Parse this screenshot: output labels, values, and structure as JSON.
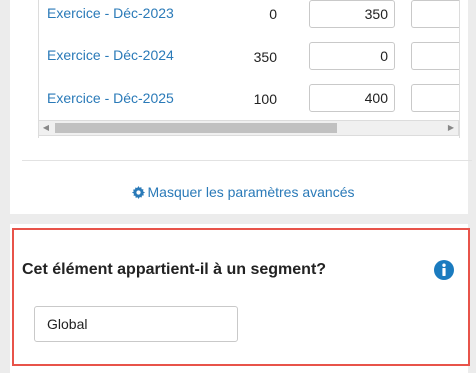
{
  "table": {
    "rows": [
      {
        "label": "Exercice - Déc-2023",
        "value": "0",
        "input": "350"
      },
      {
        "label": "Exercice - Déc-2024",
        "value": "350",
        "input": "0"
      },
      {
        "label": "Exercice - Déc-2025",
        "value": "100",
        "input": "400"
      }
    ],
    "scroll_left_icon": "arrow-left-icon",
    "scroll_right_icon": "arrow-right-icon"
  },
  "advanced": {
    "icon": "gear-icon",
    "label": "Masquer les paramètres avancés",
    "color": "#2a7ab8"
  },
  "segment": {
    "title": "Cet élément appartient-il à un segment?",
    "info_icon": "info-icon",
    "value": "Global",
    "highlight_color": "#e8534a",
    "info_color": "#1a7bbf"
  }
}
